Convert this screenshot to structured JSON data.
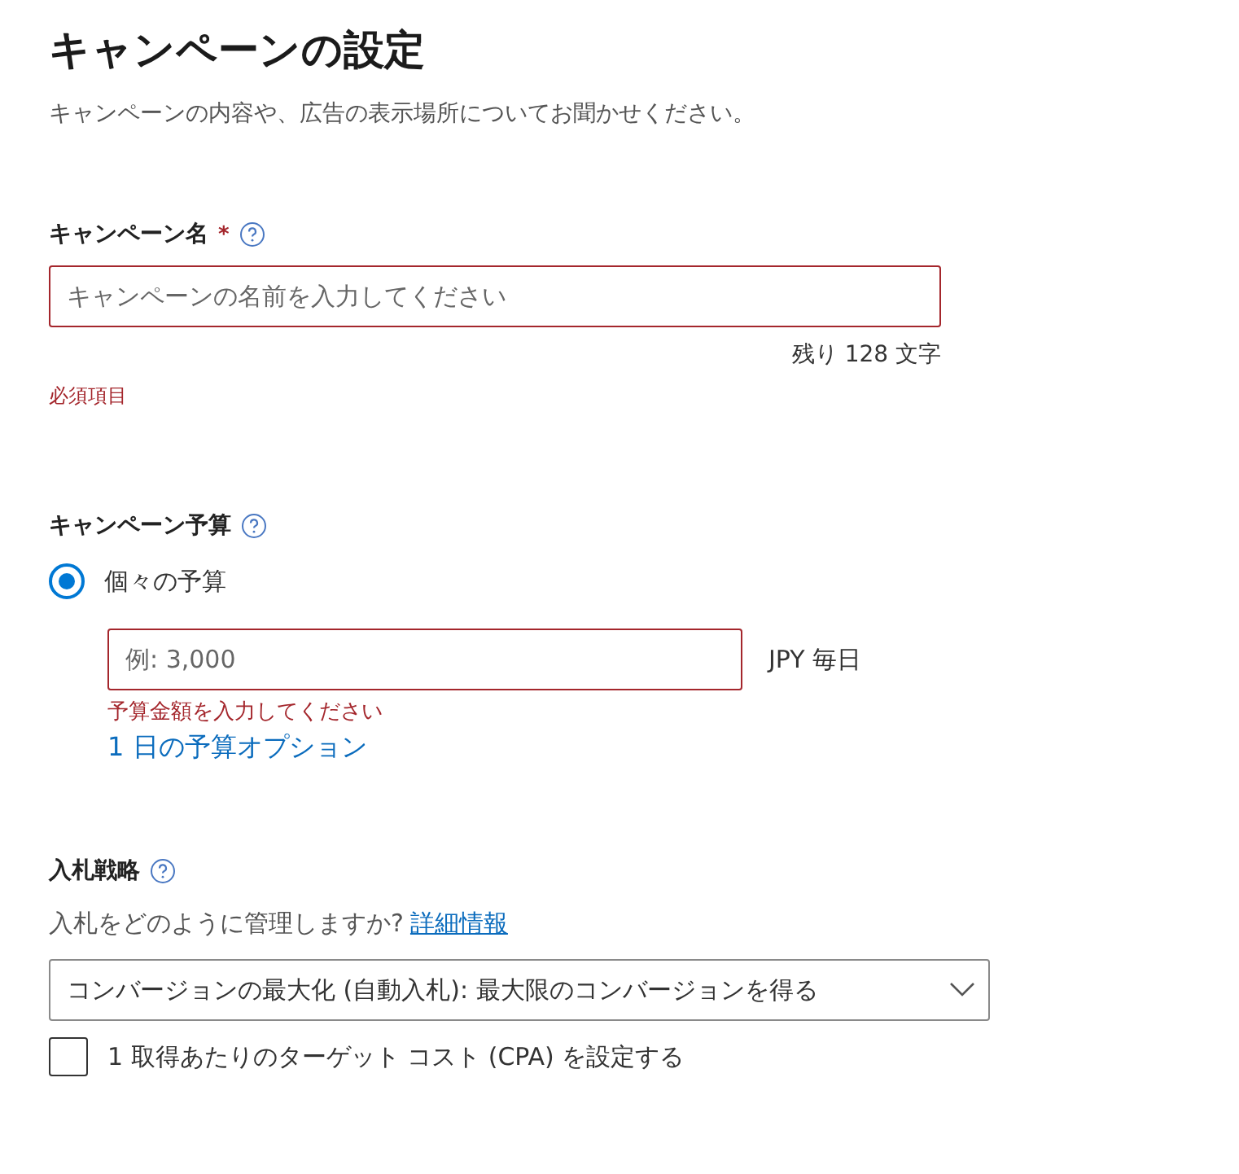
{
  "title": "キャンペーンの設定",
  "subtitle": "キャンペーンの内容や、広告の表示場所についてお聞かせください。",
  "campaign_name": {
    "label": "キャンペーン名",
    "required_mark": "*",
    "placeholder": "キャンペーンの名前を入力してください",
    "invalid": true,
    "counter": "残り 128 文字",
    "error": "必須項目"
  },
  "budget": {
    "label": "キャンペーン予算",
    "options": [
      {
        "label": "個々の予算",
        "selected": true
      }
    ],
    "placeholder": "例: 3,000",
    "invalid": true,
    "unit": "JPY 毎日",
    "error": "予算金額を入力してください",
    "link": "1 日の予算オプション"
  },
  "bidding": {
    "label": "入札戦略",
    "question": "入札をどのように管理しますか?",
    "link": "詳細情報",
    "strategy": "コンバージョンの最大化 (自動入札): 最大限のコンバージョンを得る",
    "cpa": {
      "label": "1 取得あたりのターゲット コスト (CPA) を設定する",
      "checked": false
    }
  }
}
